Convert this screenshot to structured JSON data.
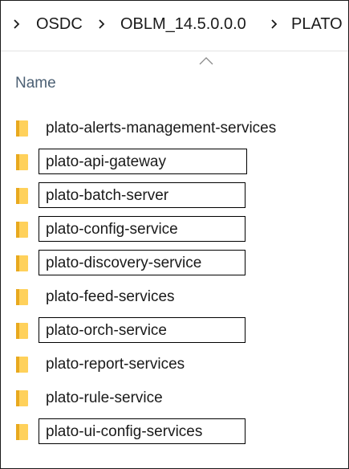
{
  "breadcrumb": {
    "items": [
      "OSDC",
      "OBLM_14.5.0.0.0",
      "PLATO"
    ]
  },
  "columns": {
    "name_label": "Name"
  },
  "files": [
    {
      "name": "plato-alerts-management-services",
      "outlined": false
    },
    {
      "name": "plato-api-gateway",
      "outlined": true
    },
    {
      "name": "plato-batch-server",
      "outlined": true
    },
    {
      "name": "plato-config-service",
      "outlined": true
    },
    {
      "name": "plato-discovery-service",
      "outlined": true
    },
    {
      "name": "plato-feed-services",
      "outlined": false
    },
    {
      "name": "plato-orch-service",
      "outlined": true
    },
    {
      "name": "plato-report-services",
      "outlined": false
    },
    {
      "name": "plato-rule-service",
      "outlined": false
    },
    {
      "name": "plato-ui-config-services",
      "outlined": true
    }
  ],
  "colors": {
    "folder": "#ffd15b",
    "folder_shadow": "#e8a91f",
    "header_text": "#4c6074",
    "outline": "#000000"
  },
  "icons": {
    "file_icon": "folder-icon",
    "separator_icon": "chevron-right-icon",
    "sort_icon": "chevron-up-icon"
  }
}
